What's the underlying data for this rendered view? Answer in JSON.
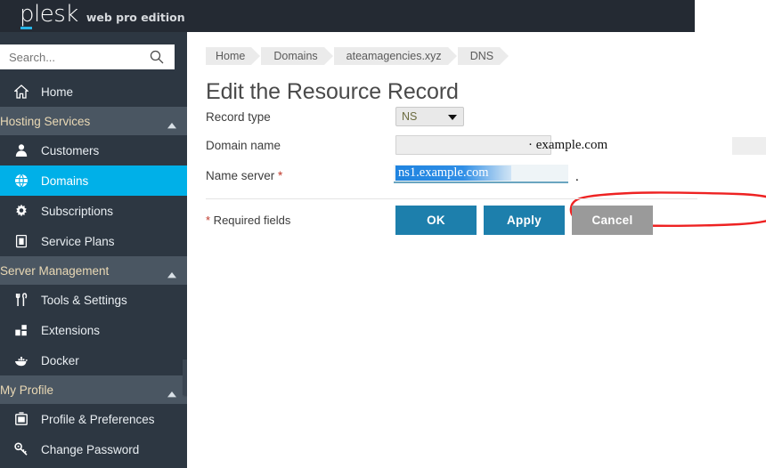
{
  "header": {
    "logo_text": "plesk",
    "edition": "web pro edition",
    "accent_color": "#28b4e6",
    "bar_color": "#242a33"
  },
  "sidebar": {
    "search": {
      "placeholder": "Search...",
      "value": "",
      "icon": "search-icon"
    },
    "collapse_handle_icon": "chevron-left-icon",
    "active_color": "#00b0e8",
    "blocks": [
      {
        "type": "item",
        "label": "Home",
        "icon": "home-icon",
        "active": false
      },
      {
        "type": "section",
        "label": "Hosting Services",
        "icon": "chevron-up-icon",
        "items": [
          {
            "label": "Customers",
            "icon": "user-icon",
            "active": false
          },
          {
            "label": "Domains",
            "icon": "globe-icon",
            "active": true
          },
          {
            "label": "Subscriptions",
            "icon": "gear-icon",
            "active": false
          },
          {
            "label": "Service Plans",
            "icon": "clipboard-icon",
            "active": false
          }
        ]
      },
      {
        "type": "section",
        "label": "Server Management",
        "icon": "chevron-up-icon",
        "items": [
          {
            "label": "Tools & Settings",
            "icon": "tools-icon",
            "active": false
          },
          {
            "label": "Extensions",
            "icon": "blocks-icon",
            "active": false
          },
          {
            "label": "Docker",
            "icon": "docker-whale-icon",
            "active": false
          }
        ]
      },
      {
        "type": "section",
        "label": "My Profile",
        "icon": "chevron-up-icon",
        "items": [
          {
            "label": "Profile & Preferences",
            "icon": "profile-card-icon",
            "active": false
          },
          {
            "label": "Change Password",
            "icon": "key-icon",
            "active": false
          }
        ]
      }
    ]
  },
  "main": {
    "breadcrumb": [
      "Home",
      "Domains",
      "ateamagencies.xyz",
      "DNS"
    ],
    "page_title": "Edit the Resource Record",
    "form": {
      "record_type": {
        "label": "Record type",
        "value": "NS",
        "caret_icon": "chevron-down-icon"
      },
      "domain_name": {
        "label": "Domain name",
        "value": "",
        "suffix": "· example.com"
      },
      "name_server": {
        "label": "Name server",
        "required_marker": "*",
        "value": "ns1.example.com",
        "trailing_dot": ".",
        "selected": true,
        "selection_color": "#2f8ee6"
      }
    },
    "required_note_star": "*",
    "required_note_text": " Required fields",
    "buttons": [
      {
        "label": "OK",
        "style": "primary",
        "color": "#1d7fac"
      },
      {
        "label": "Apply",
        "style": "primary",
        "color": "#1d7fac"
      },
      {
        "label": "Cancel",
        "style": "cancel",
        "color": "#9a9a9a"
      }
    ],
    "annotation": {
      "shape": "red-ellipse",
      "color": "#ee2222",
      "targets": "name-server-field"
    }
  }
}
